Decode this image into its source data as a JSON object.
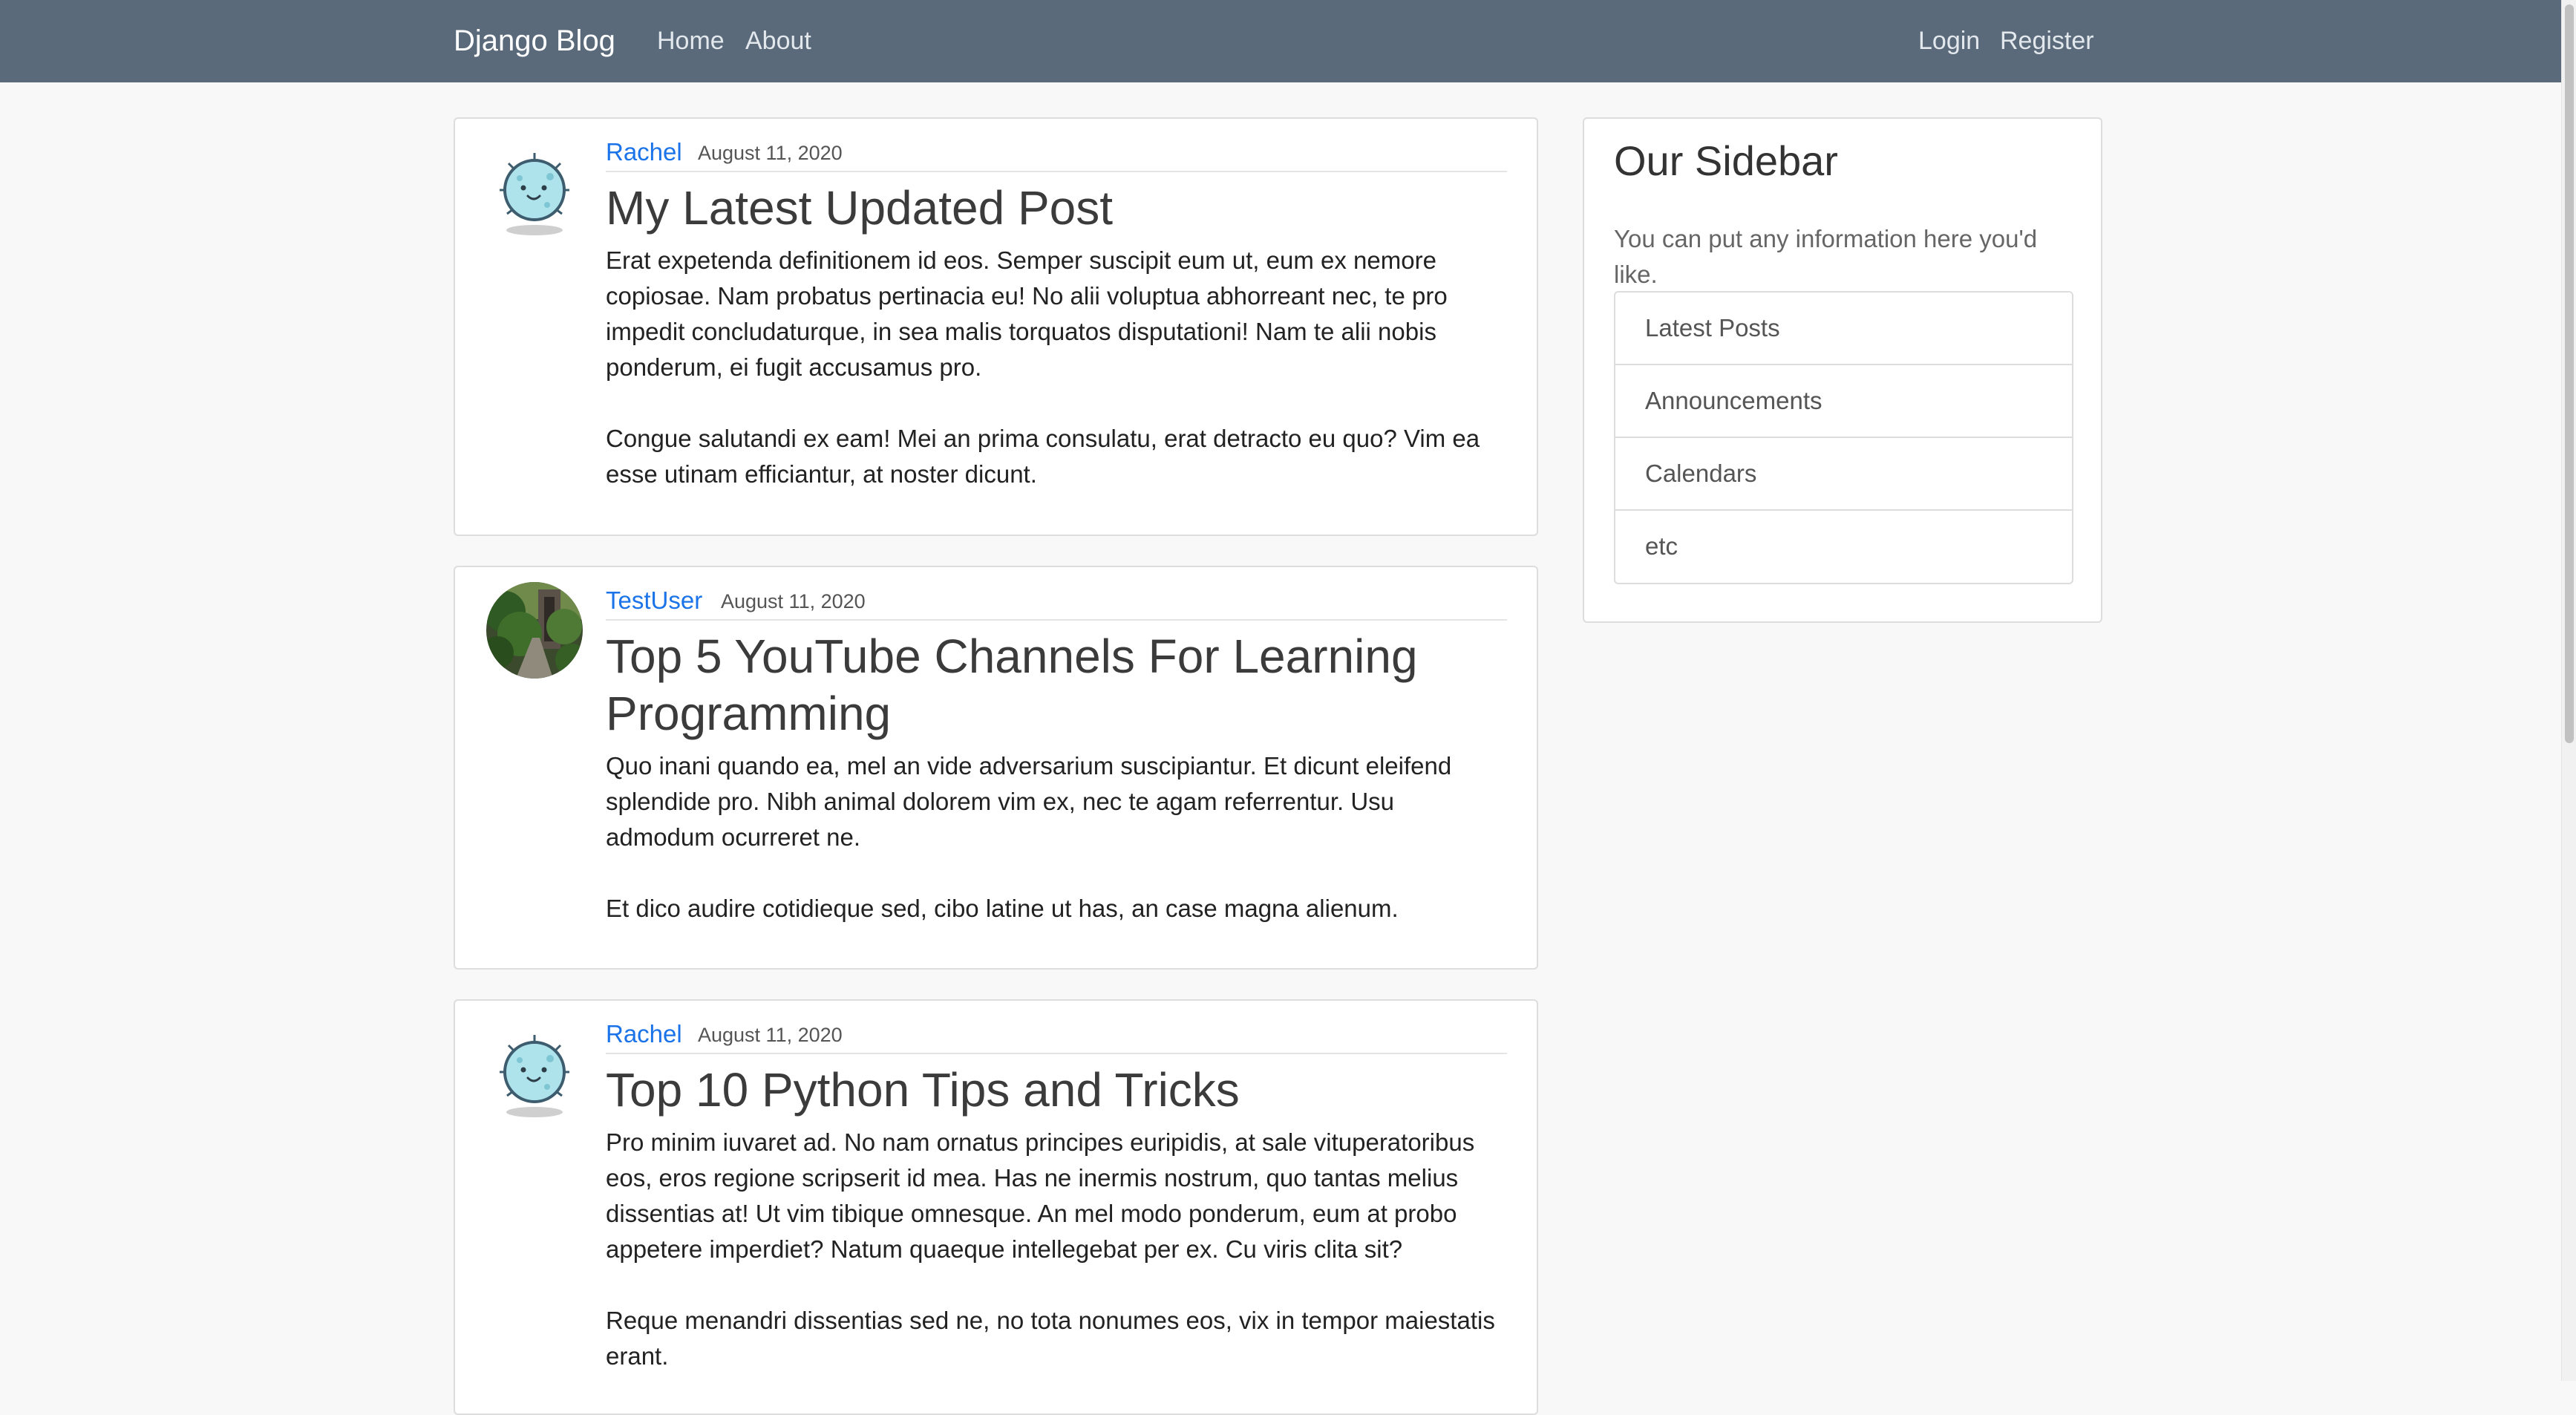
{
  "navbar": {
    "brand": "Django Blog",
    "links": [
      "Home",
      "About"
    ],
    "auth_links": [
      "Login",
      "Register"
    ]
  },
  "posts": [
    {
      "author": "Rachel",
      "date": "August 11, 2020",
      "title": "My Latest Updated Post",
      "paragraphs": [
        "Erat expetenda definitionem id eos. Semper suscipit eum ut, eum ex nemore copiosae. Nam probatus pertinacia eu! No alii voluptua abhorreant nec, te pro impedit concludaturque, in sea malis torquatos disputationi! Nam te alii nobis ponderum, ei fugit accusamus pro.",
        "Congue salutandi ex eam! Mei an prima consulatu, erat detracto eu quo? Vim ea esse utinam efficiantur, at noster dicunt."
      ],
      "avatar": "cartoon-monster-avatar"
    },
    {
      "author": "TestUser",
      "date": "August 11, 2020",
      "title": "Top 5 YouTube Channels For Learning Programming",
      "paragraphs": [
        "Quo inani quando ea, mel an vide adversarium suscipiantur. Et dicunt eleifend splendide pro. Nibh animal dolorem vim ex, nec te agam referrentur. Usu admodum ocurreret ne.",
        "Et dico audire cotidieque sed, cibo latine ut has, an case magna alienum."
      ],
      "avatar": "garden-photo-avatar"
    },
    {
      "author": "Rachel",
      "date": "August 11, 2020",
      "title": "Top 10 Python Tips and Tricks",
      "paragraphs": [
        "Pro minim iuvaret ad. No nam ornatus principes euripidis, at sale vituperatoribus eos, eros regione scripserit id mea. Has ne inermis nostrum, quo tantas melius dissentias at! Ut vim tibique omnesque. An mel modo ponderum, eum at probo appetere imperdiet? Natum quaeque intellegebat per ex. Cu viris clita sit?",
        "Reque menandri dissentias sed ne, no tota nonumes eos, vix in tempor maiestatis erant."
      ],
      "avatar": "cartoon-monster-avatar"
    }
  ],
  "sidebar": {
    "title": "Our Sidebar",
    "description": "You can put any information here you'd like.",
    "items": [
      "Latest Posts",
      "Announcements",
      "Calendars",
      "etc"
    ]
  },
  "colors": {
    "navbar": "#5a6a7b",
    "link": "#1a73e8",
    "background": "#f8f8f8"
  }
}
